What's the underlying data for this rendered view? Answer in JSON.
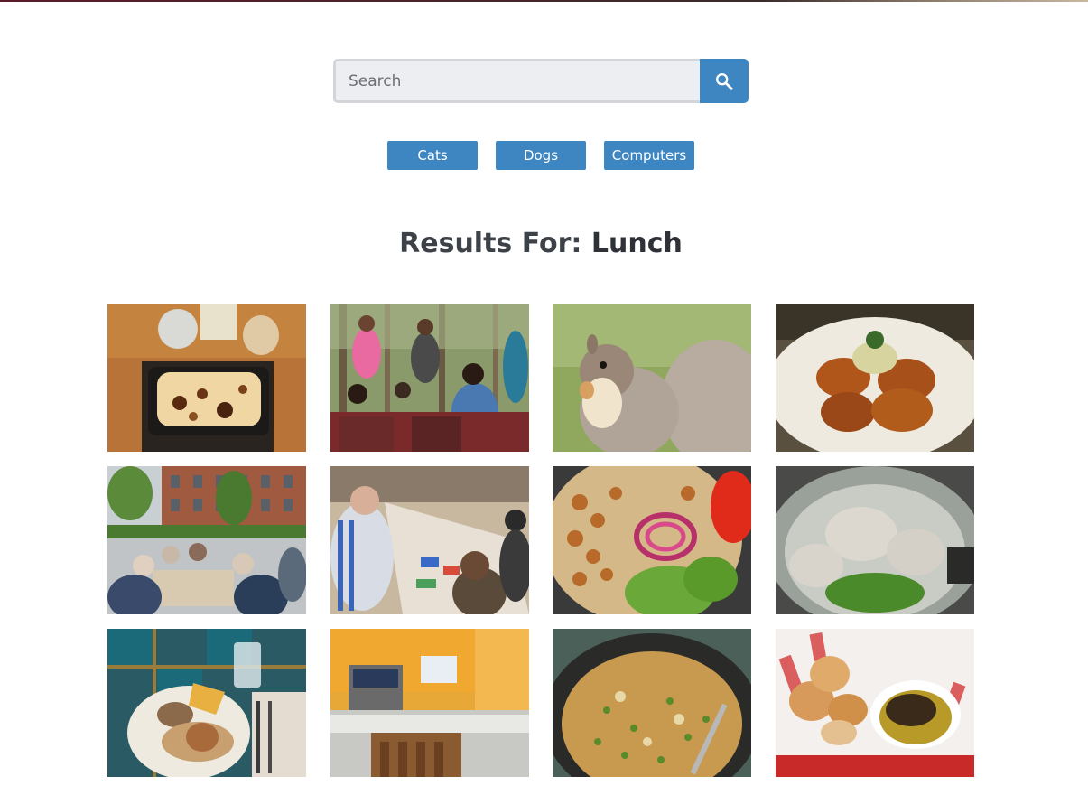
{
  "search": {
    "placeholder": "Search",
    "value": "",
    "button_icon": "search-icon"
  },
  "tags": [
    {
      "label": "Cats"
    },
    {
      "label": "Dogs"
    },
    {
      "label": "Computers"
    }
  ],
  "results": {
    "prefix": "Results For:",
    "query": "Lunch"
  },
  "images": [
    {
      "subject": "baked-casserole"
    },
    {
      "subject": "people-eating-in-forest"
    },
    {
      "subject": "squirrel-eating"
    },
    {
      "subject": "fried-potato-pancakes"
    },
    {
      "subject": "outdoor-group-lunch"
    },
    {
      "subject": "group-painting-at-table"
    },
    {
      "subject": "salad-with-onions"
    },
    {
      "subject": "dumplings-in-broth"
    },
    {
      "subject": "burrito-plate"
    },
    {
      "subject": "cafeteria-interior"
    },
    {
      "subject": "fried-rice-bowl"
    },
    {
      "subject": "bread-and-dip"
    }
  ],
  "colors": {
    "accent": "#3e86c2",
    "title": "#3d4148"
  }
}
